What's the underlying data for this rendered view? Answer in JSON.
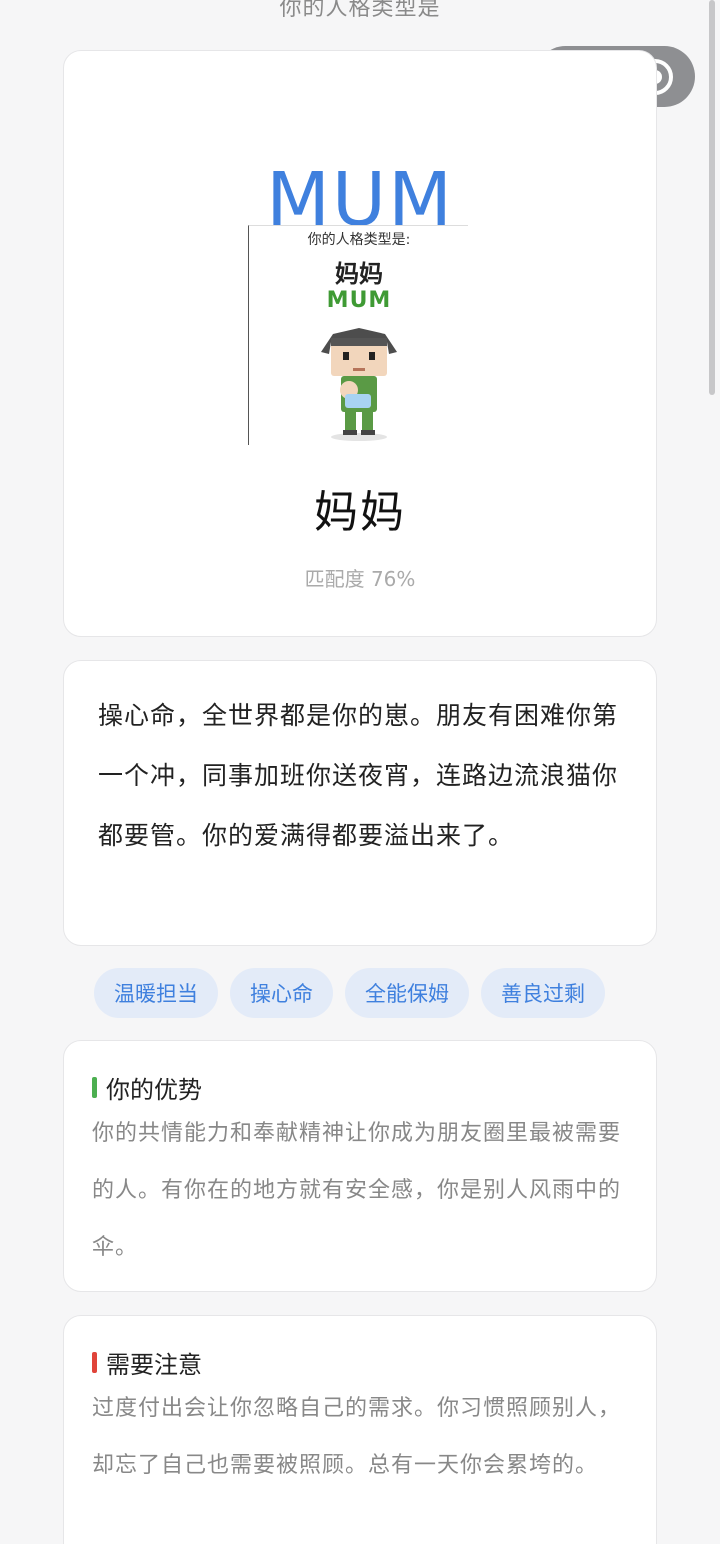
{
  "page": {
    "caption": "你的人格类型是"
  },
  "capsule": {
    "more_icon": "ellipsis-icon",
    "close_icon": "target-circle-icon"
  },
  "result": {
    "code": "MUM",
    "poster": {
      "caption": "你的人格类型是:",
      "name": "妈妈",
      "code": "MUM"
    },
    "name": "妈妈",
    "match_label": "匹配度 76%",
    "match_percent": 76,
    "accent_color": "#3f80de"
  },
  "description": "操心命，全世界都是你的崽。朋友有困难你第一个冲，同事加班你送夜宵，连路边流浪猫你都要管。你的爱满得都要溢出来了。",
  "tags": [
    "温暖担当",
    "操心命",
    "全能保姆",
    "善良过剩"
  ],
  "advantage": {
    "title": "你的优势",
    "bar_color": "#4caf50",
    "body": "你的共情能力和奉献精神让你成为朋友圈里最被需要的人。有你在的地方就有安全感，你是别人风雨中的伞。"
  },
  "caution": {
    "title": "需要注意",
    "bar_color": "#e0443a",
    "body": "过度付出会让你忽略自己的需求。你习惯照顾别人，却忘了自己也需要被照顾。总有一天你会累垮的。"
  }
}
